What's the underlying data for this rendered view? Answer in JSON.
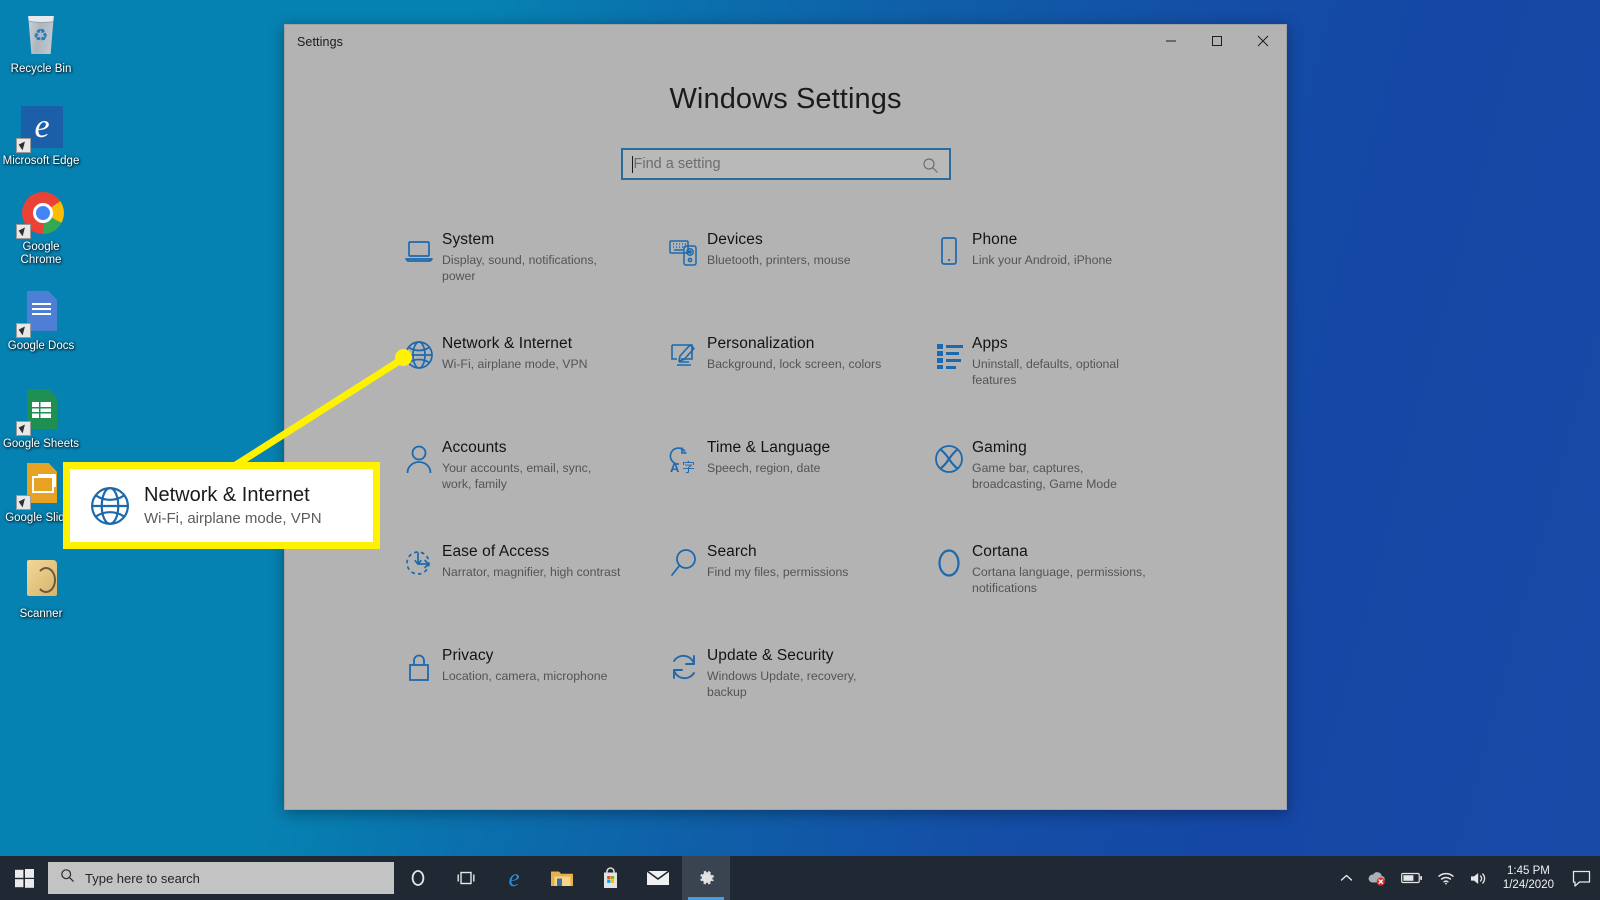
{
  "desktop": {
    "icons": [
      {
        "name": "recycle-bin",
        "label": "Recycle Bin",
        "shortcut": false
      },
      {
        "name": "microsoft-edge",
        "label": "Microsoft Edge",
        "shortcut": true
      },
      {
        "name": "google-chrome",
        "label": "Google Chrome",
        "shortcut": true
      },
      {
        "name": "google-docs",
        "label": "Google Docs",
        "shortcut": true
      },
      {
        "name": "google-sheets",
        "label": "Google Sheets",
        "shortcut": true
      },
      {
        "name": "google-slides",
        "label": "Google Slides",
        "shortcut": true
      },
      {
        "name": "scanner",
        "label": "Scanner",
        "shortcut": false
      }
    ],
    "wallpaper_color_left": "#0682b2",
    "wallpaper_color_right": "#1547a6"
  },
  "window": {
    "title": "Settings",
    "controls": {
      "minimize": "minimize-icon",
      "maximize": "maximize-icon",
      "close": "close-icon"
    }
  },
  "settings": {
    "heading": "Windows Settings",
    "search": {
      "placeholder": "Find a setting",
      "value": "",
      "icon": "search-icon",
      "border_color": "#2a6b99"
    },
    "accent_color": "#1d69ad",
    "tiles": [
      {
        "id": "system",
        "icon": "monitor-icon",
        "title": "System",
        "subtitle": "Display, sound, notifications, power"
      },
      {
        "id": "devices",
        "icon": "devices-icon",
        "title": "Devices",
        "subtitle": "Bluetooth, printers, mouse"
      },
      {
        "id": "phone",
        "icon": "phone-icon",
        "title": "Phone",
        "subtitle": "Link your Android, iPhone"
      },
      {
        "id": "network",
        "icon": "globe-icon",
        "title": "Network & Internet",
        "subtitle": "Wi-Fi, airplane mode, VPN"
      },
      {
        "id": "personalization",
        "icon": "brush-icon",
        "title": "Personalization",
        "subtitle": "Background, lock screen, colors"
      },
      {
        "id": "apps",
        "icon": "list-icon",
        "title": "Apps",
        "subtitle": "Uninstall, defaults, optional features"
      },
      {
        "id": "accounts",
        "icon": "person-icon",
        "title": "Accounts",
        "subtitle": "Your accounts, email, sync, work, family"
      },
      {
        "id": "time-language",
        "icon": "clock-language-icon",
        "title": "Time & Language",
        "subtitle": "Speech, region, date"
      },
      {
        "id": "gaming",
        "icon": "xbox-icon",
        "title": "Gaming",
        "subtitle": "Game bar, captures, broadcasting, Game Mode"
      },
      {
        "id": "ease-of-access",
        "icon": "accessibility-clock-icon",
        "title": "Ease of Access",
        "subtitle": "Narrator, magnifier, high contrast"
      },
      {
        "id": "search",
        "icon": "magnifier-icon",
        "title": "Search",
        "subtitle": "Find my files, permissions"
      },
      {
        "id": "cortana",
        "icon": "cortana-ring-icon",
        "title": "Cortana",
        "subtitle": "Cortana language, permissions, notifications"
      },
      {
        "id": "privacy",
        "icon": "lock-icon",
        "title": "Privacy",
        "subtitle": "Location, camera, microphone"
      },
      {
        "id": "update-security",
        "icon": "refresh-icon",
        "title": "Update & Security",
        "subtitle": "Windows Update, recovery, backup"
      }
    ]
  },
  "callout": {
    "icon": "globe-icon",
    "title": "Network & Internet",
    "subtitle": "Wi-Fi, airplane mode, VPN",
    "highlight_color": "#fff200",
    "target_tile": "network"
  },
  "taskbar": {
    "start": "windows-logo-icon",
    "search": {
      "placeholder": "Type here to search",
      "value": "Type here to search",
      "icon": "search-icon"
    },
    "buttons": [
      {
        "id": "cortana",
        "icon": "cortana-circle-icon",
        "active": false
      },
      {
        "id": "task-view",
        "icon": "task-view-icon",
        "active": false
      },
      {
        "id": "edge",
        "icon": "edge-icon",
        "active": false
      },
      {
        "id": "file-explorer",
        "icon": "folder-icon",
        "active": false
      },
      {
        "id": "microsoft-store",
        "icon": "store-bag-icon",
        "active": false
      },
      {
        "id": "mail",
        "icon": "mail-icon",
        "active": false
      },
      {
        "id": "settings",
        "icon": "gear-icon",
        "active": true
      }
    ],
    "tray": [
      {
        "id": "show-hidden-icons",
        "icon": "chevron-up-icon"
      },
      {
        "id": "onedrive-error",
        "icon": "onedrive-error-icon"
      },
      {
        "id": "battery",
        "icon": "battery-icon"
      },
      {
        "id": "network-wifi",
        "icon": "wifi-icon"
      },
      {
        "id": "volume",
        "icon": "speaker-icon"
      }
    ],
    "clock": {
      "time": "1:45 PM",
      "date": "1/24/2020"
    },
    "action_center": "action-center-icon"
  }
}
